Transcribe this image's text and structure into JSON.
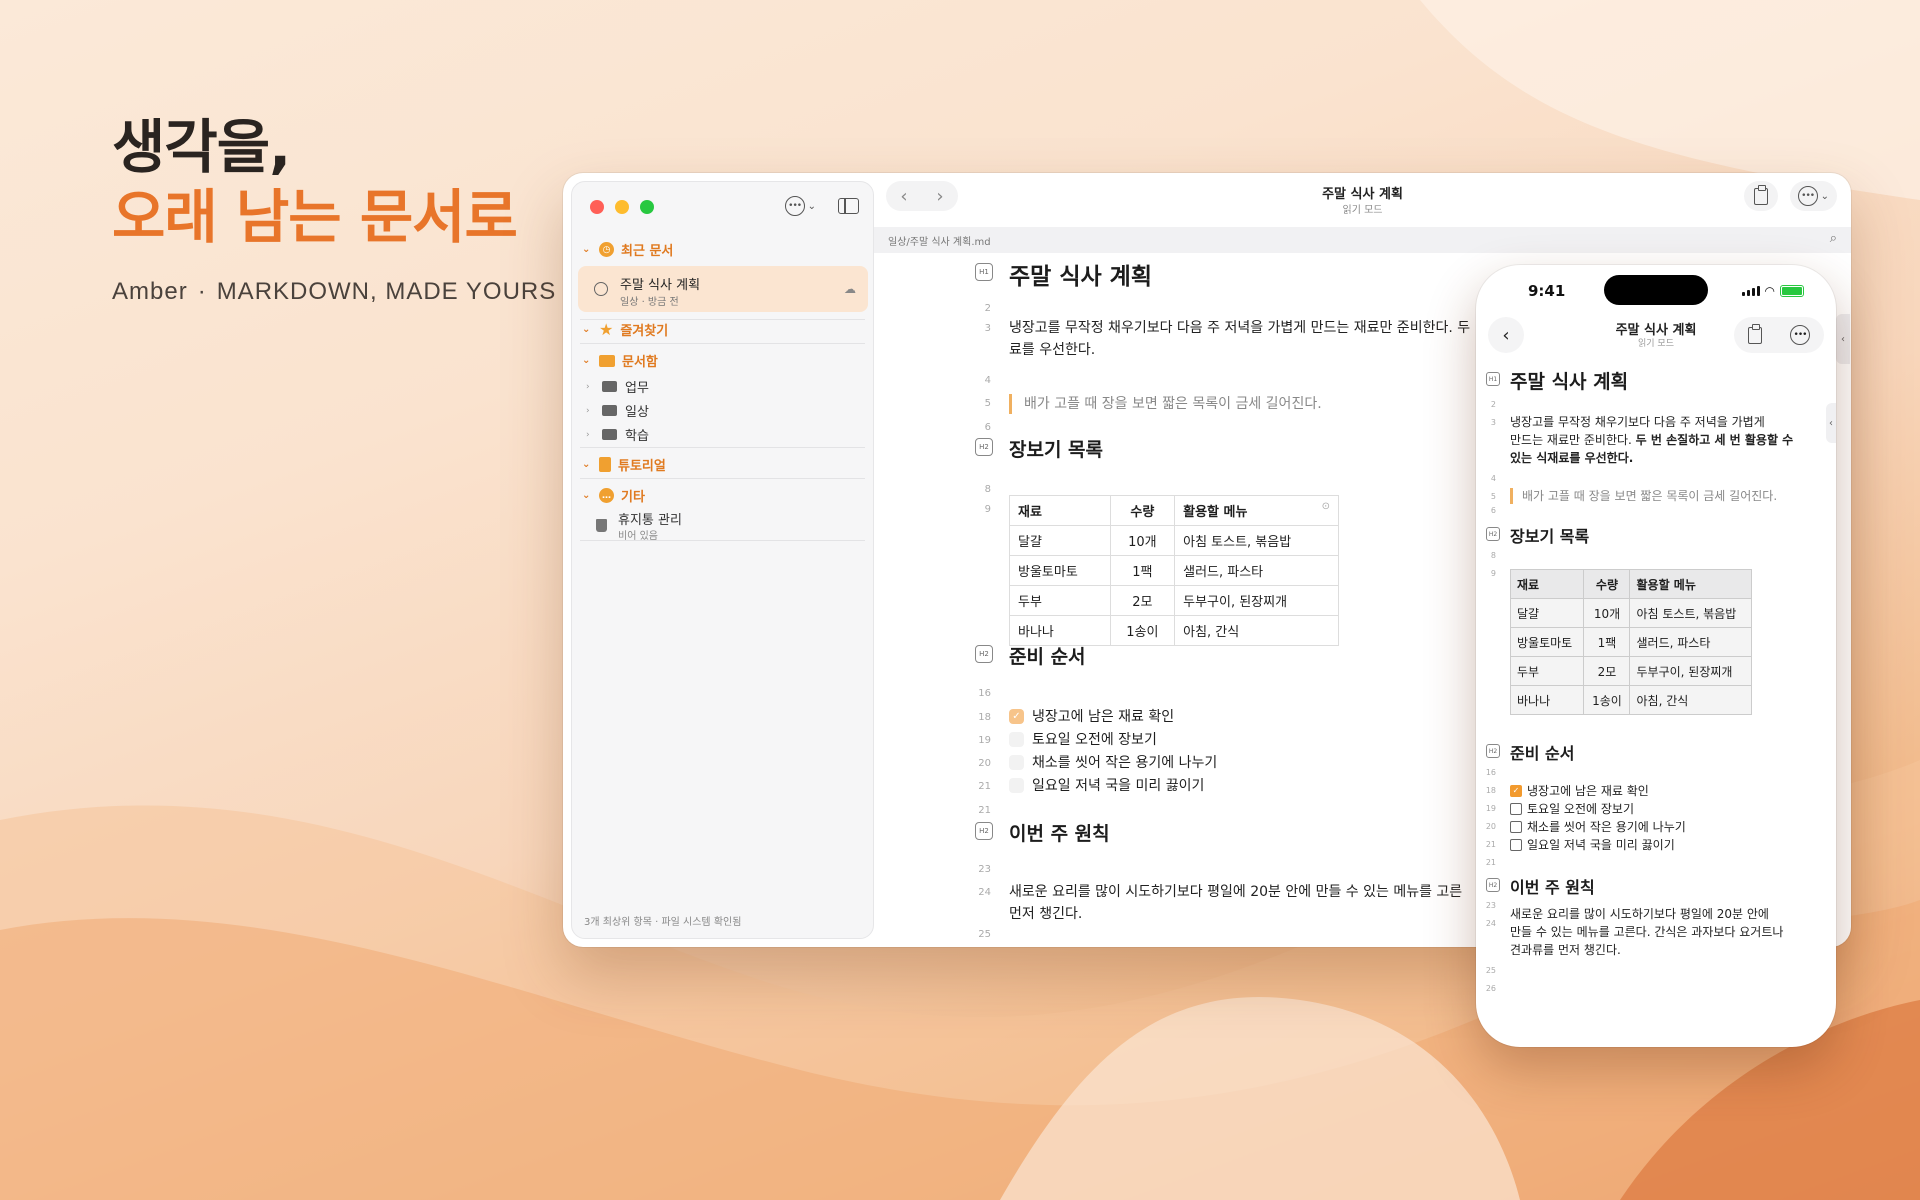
{
  "hero": {
    "line1": "생각을,",
    "line2": "오래 남는 문서로",
    "brand": "Amber",
    "sep": "·",
    "tagline": "MARKDOWN, MADE YOURS"
  },
  "sidebar": {
    "recent_label": "최근 문서",
    "recent_item": {
      "title": "주말 식사 계획",
      "sub": "일상 · 방금 전"
    },
    "favorites_label": "즐겨찾기",
    "docs_label": "문서함",
    "folders": [
      "업무",
      "일상",
      "학습"
    ],
    "tutorial_label": "튜토리얼",
    "etc_label": "기타",
    "trash": {
      "title": "휴지통 관리",
      "sub": "비어 있음"
    },
    "footer": "3개 최상위 항목 · 파일 시스템 확인됨"
  },
  "window": {
    "title": "주말 식사 계획",
    "mode": "읽기 모드",
    "path": "일상/주말 식사 계획.md"
  },
  "doc": {
    "h1": "주말 식사 계획",
    "intro_l1": "냉장고를 무작정 채우기보다 다음 주 저녁을 가볍게 만드는 재료만 준비한다. 두",
    "intro_l2": "료를 우선한다.",
    "quote": "배가 고플 때 장을 보면 짧은 목록이 금세 길어진다.",
    "h2_shopping": "장보기 목록",
    "table_headers": [
      "재료",
      "수량",
      "활용할 메뉴"
    ],
    "table_rows": [
      [
        "달걀",
        "10개",
        "아침 토스트, 볶음밥"
      ],
      [
        "방울토마토",
        "1팩",
        "샐러드, 파스타"
      ],
      [
        "두부",
        "2모",
        "두부구이, 된장찌개"
      ],
      [
        "바나나",
        "1송이",
        "아침, 간식"
      ]
    ],
    "h2_prep": "준비 순서",
    "tasks": [
      {
        "text": "냉장고에 남은 재료 확인",
        "done": true
      },
      {
        "text": "토요일 오전에 장보기",
        "done": false
      },
      {
        "text": "채소를 씻어 작은 용기에 나누기",
        "done": false
      },
      {
        "text": "일요일 저녁 국을 미리 끓이기",
        "done": false
      }
    ],
    "h2_rules": "이번 주 원칙",
    "rules_l1": "새로운 요리를 많이 시도하기보다 평일에 20분 안에 만들 수 있는 메뉴를 고른",
    "rules_l2": "먼저 챙긴다.",
    "line_numbers": [
      "2",
      "3",
      "4",
      "5",
      "6",
      "8",
      "9",
      "16",
      "18",
      "19",
      "20",
      "21",
      "21",
      "23",
      "24",
      "25"
    ],
    "head_badges": {
      "h1": "H1",
      "h2": "H2"
    }
  },
  "phone": {
    "time": "9:41",
    "title": "주말 식사 계획",
    "mode": "읽기 모드",
    "h1": "주말 식사 계획",
    "intro_l1": "냉장고를 무작정 채우기보다 다음 주 저녁을 가볍게",
    "intro_l2a": "만드는 재료만 준비한다. ",
    "intro_l2b": "두 번 손질하고 세 번 활용할 수",
    "intro_l3": "있는 식재료를 우선한다.",
    "quote": "배가 고플 때 장을 보면 짧은 목록이 금세 길어진다.",
    "h2_shopping": "장보기 목록",
    "h2_prep": "준비 순서",
    "h2_rules": "이번 주 원칙",
    "rules_l1": "새로운 요리를 많이 시도하기보다 평일에 20분 안에",
    "rules_l2": "만들 수 있는 메뉴를 고른다. 간식은 과자보다 요거트나",
    "rules_l3": "견과류를 먼저 챙긴다.",
    "line_numbers": [
      "2",
      "3",
      "4",
      "5",
      "6",
      "8",
      "9",
      "16",
      "18",
      "19",
      "20",
      "21",
      "21",
      "23",
      "24",
      "25",
      "26"
    ]
  },
  "icons": {
    "back": "chevron-left-icon",
    "forward": "chevron-right-icon",
    "more": "ellipsis-circle-icon",
    "sidebar": "sidebar-toggle-icon",
    "clipboard": "clipboard-icon",
    "search": "search-icon",
    "cloud": "cloud-icon"
  },
  "colors": {
    "accent": "#e8752a",
    "accent_light": "#fbe5d1"
  }
}
